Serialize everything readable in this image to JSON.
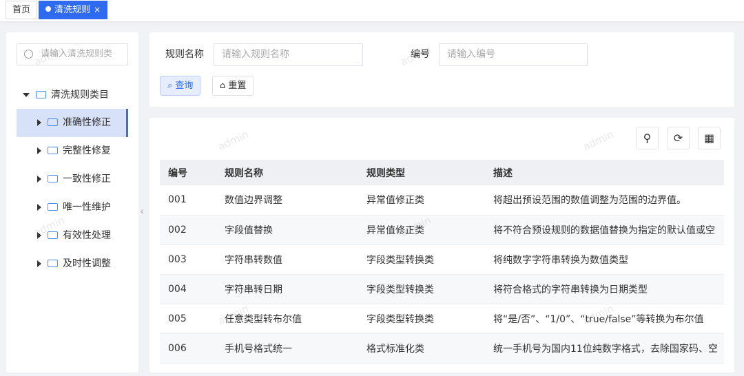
{
  "tabs": [
    {
      "label": "首页"
    },
    {
      "label": "清洗规则",
      "close": "×"
    }
  ],
  "tree": {
    "search_placeholder": "请输入清洗规则类",
    "root": "清洗规则类目",
    "nodes": [
      {
        "label": "准确性修正"
      },
      {
        "label": "完整性修复"
      },
      {
        "label": "一致性修正"
      },
      {
        "label": "唯一性维护"
      },
      {
        "label": "有效性处理"
      },
      {
        "label": "及时性调整"
      }
    ]
  },
  "query": {
    "name_label": "规则名称",
    "name_placeholder": "请输入规则名称",
    "code_label": "编号",
    "code_placeholder": "请输入编号",
    "search_btn": "查询",
    "reset_btn": "重置"
  },
  "table": {
    "headers": [
      "编号",
      "规则名称",
      "规则类型",
      "描述"
    ],
    "rows": [
      [
        "001",
        "数值边界调整",
        "异常值修正类",
        "将超出预设范围的数值调整为范围的边界值。"
      ],
      [
        "002",
        "字段值替换",
        "异常值修正类",
        "将不符合预设规则的数据值替换为指定的默认值或空"
      ],
      [
        "003",
        "字符串转数值",
        "字段类型转换类",
        "将纯数字字符串转换为数值类型"
      ],
      [
        "004",
        "字符串转日期",
        "字段类型转换类",
        "将符合格式的字符串转换为日期类型"
      ],
      [
        "005",
        "任意类型转布尔值",
        "字段类型转换类",
        "将“是/否”、“1/0”、“true/false”等转换为布尔值"
      ],
      [
        "006",
        "手机号格式统一",
        "格式标准化类",
        "统一手机号为国内11位纯数字格式，去除国家码、空"
      ]
    ]
  },
  "watermark": "admin"
}
